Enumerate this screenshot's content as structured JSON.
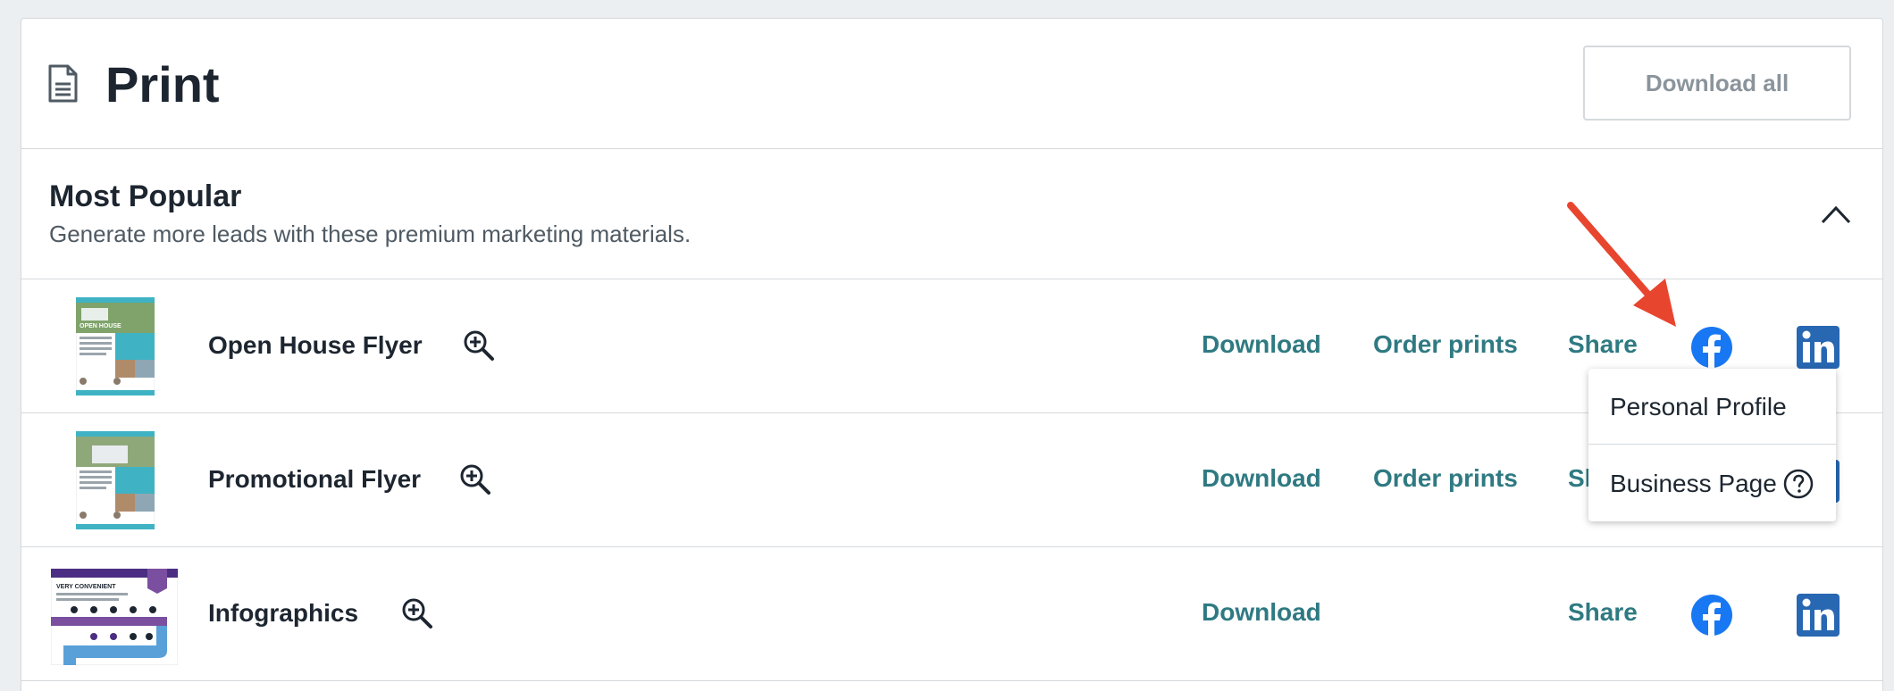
{
  "header": {
    "title": "Print",
    "download_all_label": "Download all",
    "icon": "document-icon"
  },
  "section": {
    "title": "Most Popular",
    "subtitle": "Generate more leads with these premium marketing materials.",
    "toggle_icon": "chevron-up-icon"
  },
  "rows": [
    {
      "name": "Open House Flyer",
      "download": "Download",
      "order": "Order prints",
      "share": "Share"
    },
    {
      "name": "Promotional Flyer",
      "download": "Download",
      "order": "Order prints",
      "share": "Share"
    },
    {
      "name": "Infographics",
      "download": "Download",
      "order": "",
      "share": "Share"
    }
  ],
  "thumb_texts": {
    "open_house": "OPEN HOUSE",
    "infographic_heading": "VERY CONVENIENT"
  },
  "share_dropdown": {
    "personal": "Personal Profile",
    "business": "Business Page"
  },
  "colors": {
    "link": "#2f7a82",
    "facebook": "#1877f2",
    "linkedin": "#2867b2",
    "arrow": "#e8452f"
  }
}
